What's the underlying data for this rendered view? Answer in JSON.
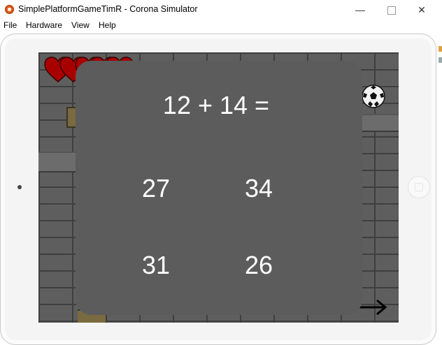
{
  "window": {
    "title": "SimplePlatformGameTimR - Corona Simulator",
    "app_icon": "corona-icon",
    "controls": {
      "minimize": "—",
      "close": "✕"
    }
  },
  "menu": {
    "items": [
      "File",
      "Hardware",
      "View",
      "Help"
    ]
  },
  "game": {
    "lives": 5,
    "heart_color": "#a80000",
    "icons": [
      "heart-icon",
      "soccer-ball-icon",
      "arrow-right-icon",
      "door-icon"
    ]
  },
  "quiz": {
    "question": "12 + 14 =",
    "answers": [
      "27",
      "34",
      "31",
      "26"
    ]
  }
}
